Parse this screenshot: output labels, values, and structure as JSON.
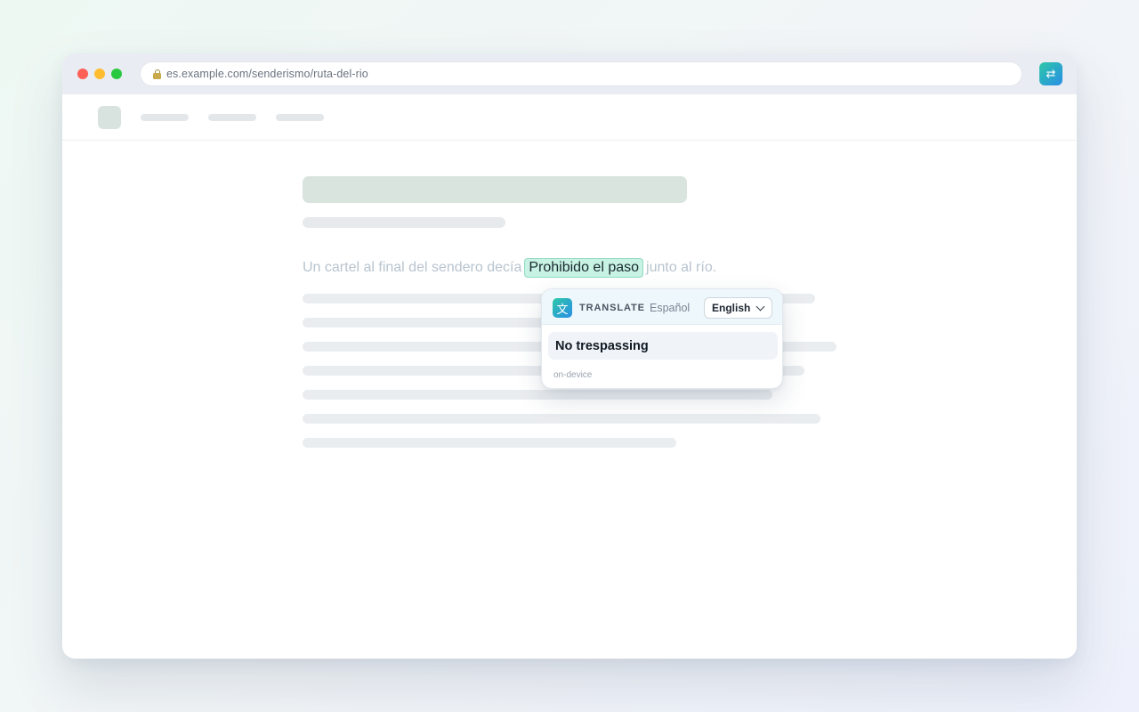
{
  "browser": {
    "url": "es.example.com/senderismo/ruta-del-rio",
    "lock_icon": "lock-icon",
    "extension_icon": "translate-swap-icon",
    "extension_glyph": "⇄"
  },
  "article": {
    "sentence": {
      "before": "Un cartel al final del sendero decía",
      "highlighted": "Prohibido el paso",
      "after": "junto al río."
    }
  },
  "translate_popup": {
    "icon": "translate-icon",
    "icon_glyph": "文",
    "label": "TRANSLATE",
    "source_language": "Español",
    "target_language": "English",
    "translation": "No trespassing",
    "footnote": "on-device"
  },
  "colors": {
    "accent_gradient_start": "#2cc7a8",
    "accent_gradient_end": "#2a8ee6",
    "highlight_bg": "#c8f2e3",
    "highlight_border": "#8fdcc2"
  }
}
